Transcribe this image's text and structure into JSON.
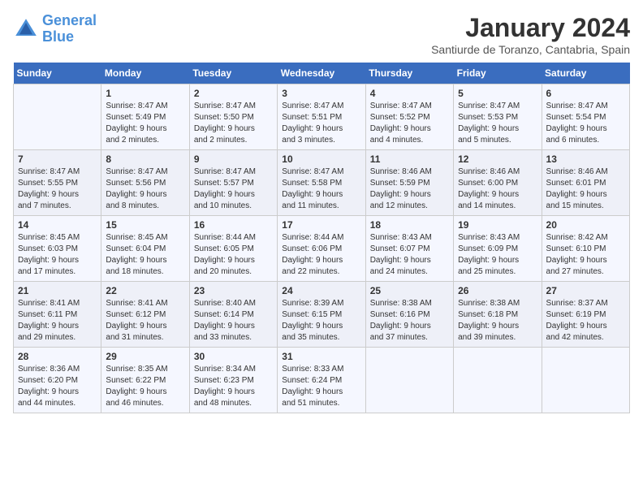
{
  "header": {
    "logo_line1": "General",
    "logo_line2": "Blue",
    "month_title": "January 2024",
    "location": "Santiurde de Toranzo, Cantabria, Spain"
  },
  "weekdays": [
    "Sunday",
    "Monday",
    "Tuesday",
    "Wednesday",
    "Thursday",
    "Friday",
    "Saturday"
  ],
  "weeks": [
    [
      {
        "day": "",
        "info": ""
      },
      {
        "day": "1",
        "info": "Sunrise: 8:47 AM\nSunset: 5:49 PM\nDaylight: 9 hours\nand 2 minutes."
      },
      {
        "day": "2",
        "info": "Sunrise: 8:47 AM\nSunset: 5:50 PM\nDaylight: 9 hours\nand 2 minutes."
      },
      {
        "day": "3",
        "info": "Sunrise: 8:47 AM\nSunset: 5:51 PM\nDaylight: 9 hours\nand 3 minutes."
      },
      {
        "day": "4",
        "info": "Sunrise: 8:47 AM\nSunset: 5:52 PM\nDaylight: 9 hours\nand 4 minutes."
      },
      {
        "day": "5",
        "info": "Sunrise: 8:47 AM\nSunset: 5:53 PM\nDaylight: 9 hours\nand 5 minutes."
      },
      {
        "day": "6",
        "info": "Sunrise: 8:47 AM\nSunset: 5:54 PM\nDaylight: 9 hours\nand 6 minutes."
      }
    ],
    [
      {
        "day": "7",
        "info": "Sunrise: 8:47 AM\nSunset: 5:55 PM\nDaylight: 9 hours\nand 7 minutes."
      },
      {
        "day": "8",
        "info": "Sunrise: 8:47 AM\nSunset: 5:56 PM\nDaylight: 9 hours\nand 8 minutes."
      },
      {
        "day": "9",
        "info": "Sunrise: 8:47 AM\nSunset: 5:57 PM\nDaylight: 9 hours\nand 10 minutes."
      },
      {
        "day": "10",
        "info": "Sunrise: 8:47 AM\nSunset: 5:58 PM\nDaylight: 9 hours\nand 11 minutes."
      },
      {
        "day": "11",
        "info": "Sunrise: 8:46 AM\nSunset: 5:59 PM\nDaylight: 9 hours\nand 12 minutes."
      },
      {
        "day": "12",
        "info": "Sunrise: 8:46 AM\nSunset: 6:00 PM\nDaylight: 9 hours\nand 14 minutes."
      },
      {
        "day": "13",
        "info": "Sunrise: 8:46 AM\nSunset: 6:01 PM\nDaylight: 9 hours\nand 15 minutes."
      }
    ],
    [
      {
        "day": "14",
        "info": "Sunrise: 8:45 AM\nSunset: 6:03 PM\nDaylight: 9 hours\nand 17 minutes."
      },
      {
        "day": "15",
        "info": "Sunrise: 8:45 AM\nSunset: 6:04 PM\nDaylight: 9 hours\nand 18 minutes."
      },
      {
        "day": "16",
        "info": "Sunrise: 8:44 AM\nSunset: 6:05 PM\nDaylight: 9 hours\nand 20 minutes."
      },
      {
        "day": "17",
        "info": "Sunrise: 8:44 AM\nSunset: 6:06 PM\nDaylight: 9 hours\nand 22 minutes."
      },
      {
        "day": "18",
        "info": "Sunrise: 8:43 AM\nSunset: 6:07 PM\nDaylight: 9 hours\nand 24 minutes."
      },
      {
        "day": "19",
        "info": "Sunrise: 8:43 AM\nSunset: 6:09 PM\nDaylight: 9 hours\nand 25 minutes."
      },
      {
        "day": "20",
        "info": "Sunrise: 8:42 AM\nSunset: 6:10 PM\nDaylight: 9 hours\nand 27 minutes."
      }
    ],
    [
      {
        "day": "21",
        "info": "Sunrise: 8:41 AM\nSunset: 6:11 PM\nDaylight: 9 hours\nand 29 minutes."
      },
      {
        "day": "22",
        "info": "Sunrise: 8:41 AM\nSunset: 6:12 PM\nDaylight: 9 hours\nand 31 minutes."
      },
      {
        "day": "23",
        "info": "Sunrise: 8:40 AM\nSunset: 6:14 PM\nDaylight: 9 hours\nand 33 minutes."
      },
      {
        "day": "24",
        "info": "Sunrise: 8:39 AM\nSunset: 6:15 PM\nDaylight: 9 hours\nand 35 minutes."
      },
      {
        "day": "25",
        "info": "Sunrise: 8:38 AM\nSunset: 6:16 PM\nDaylight: 9 hours\nand 37 minutes."
      },
      {
        "day": "26",
        "info": "Sunrise: 8:38 AM\nSunset: 6:18 PM\nDaylight: 9 hours\nand 39 minutes."
      },
      {
        "day": "27",
        "info": "Sunrise: 8:37 AM\nSunset: 6:19 PM\nDaylight: 9 hours\nand 42 minutes."
      }
    ],
    [
      {
        "day": "28",
        "info": "Sunrise: 8:36 AM\nSunset: 6:20 PM\nDaylight: 9 hours\nand 44 minutes."
      },
      {
        "day": "29",
        "info": "Sunrise: 8:35 AM\nSunset: 6:22 PM\nDaylight: 9 hours\nand 46 minutes."
      },
      {
        "day": "30",
        "info": "Sunrise: 8:34 AM\nSunset: 6:23 PM\nDaylight: 9 hours\nand 48 minutes."
      },
      {
        "day": "31",
        "info": "Sunrise: 8:33 AM\nSunset: 6:24 PM\nDaylight: 9 hours\nand 51 minutes."
      },
      {
        "day": "",
        "info": ""
      },
      {
        "day": "",
        "info": ""
      },
      {
        "day": "",
        "info": ""
      }
    ]
  ]
}
